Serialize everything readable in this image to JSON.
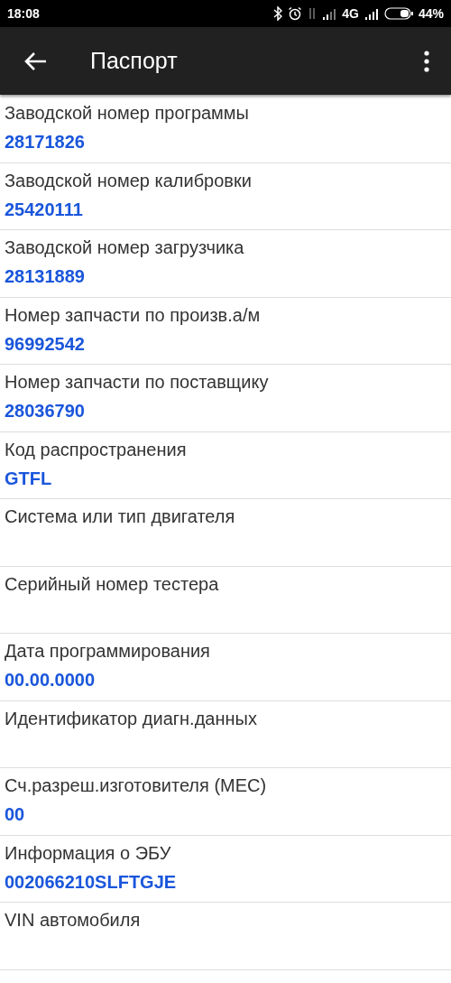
{
  "status_bar": {
    "time": "18:08",
    "network": "4G",
    "battery": "44%"
  },
  "app_bar": {
    "title": "Паспорт"
  },
  "rows": [
    {
      "label": "Заводской номер программы",
      "value": "28171826"
    },
    {
      "label": "Заводской номер калибровки",
      "value": "25420111"
    },
    {
      "label": "Заводской номер загрузчика",
      "value": "28131889"
    },
    {
      "label": "Номер запчасти по произв.а/м",
      "value": "96992542"
    },
    {
      "label": "Номер запчасти по поставщику",
      "value": "28036790"
    },
    {
      "label": "Код распространения",
      "value": "GTFL"
    },
    {
      "label": "Система или тип двигателя"
    },
    {
      "label": "Серийный номер тестера"
    },
    {
      "label": "Дата программирования",
      "value": "00.00.0000"
    },
    {
      "label": "Идентификатор диагн.данных"
    },
    {
      "label": "Сч.разреш.изготовителя (MEC)",
      "value": "00"
    },
    {
      "label": "Информация о ЭБУ",
      "value": "002066210SLFTGJE"
    },
    {
      "label": "VIN автомобиля"
    }
  ]
}
